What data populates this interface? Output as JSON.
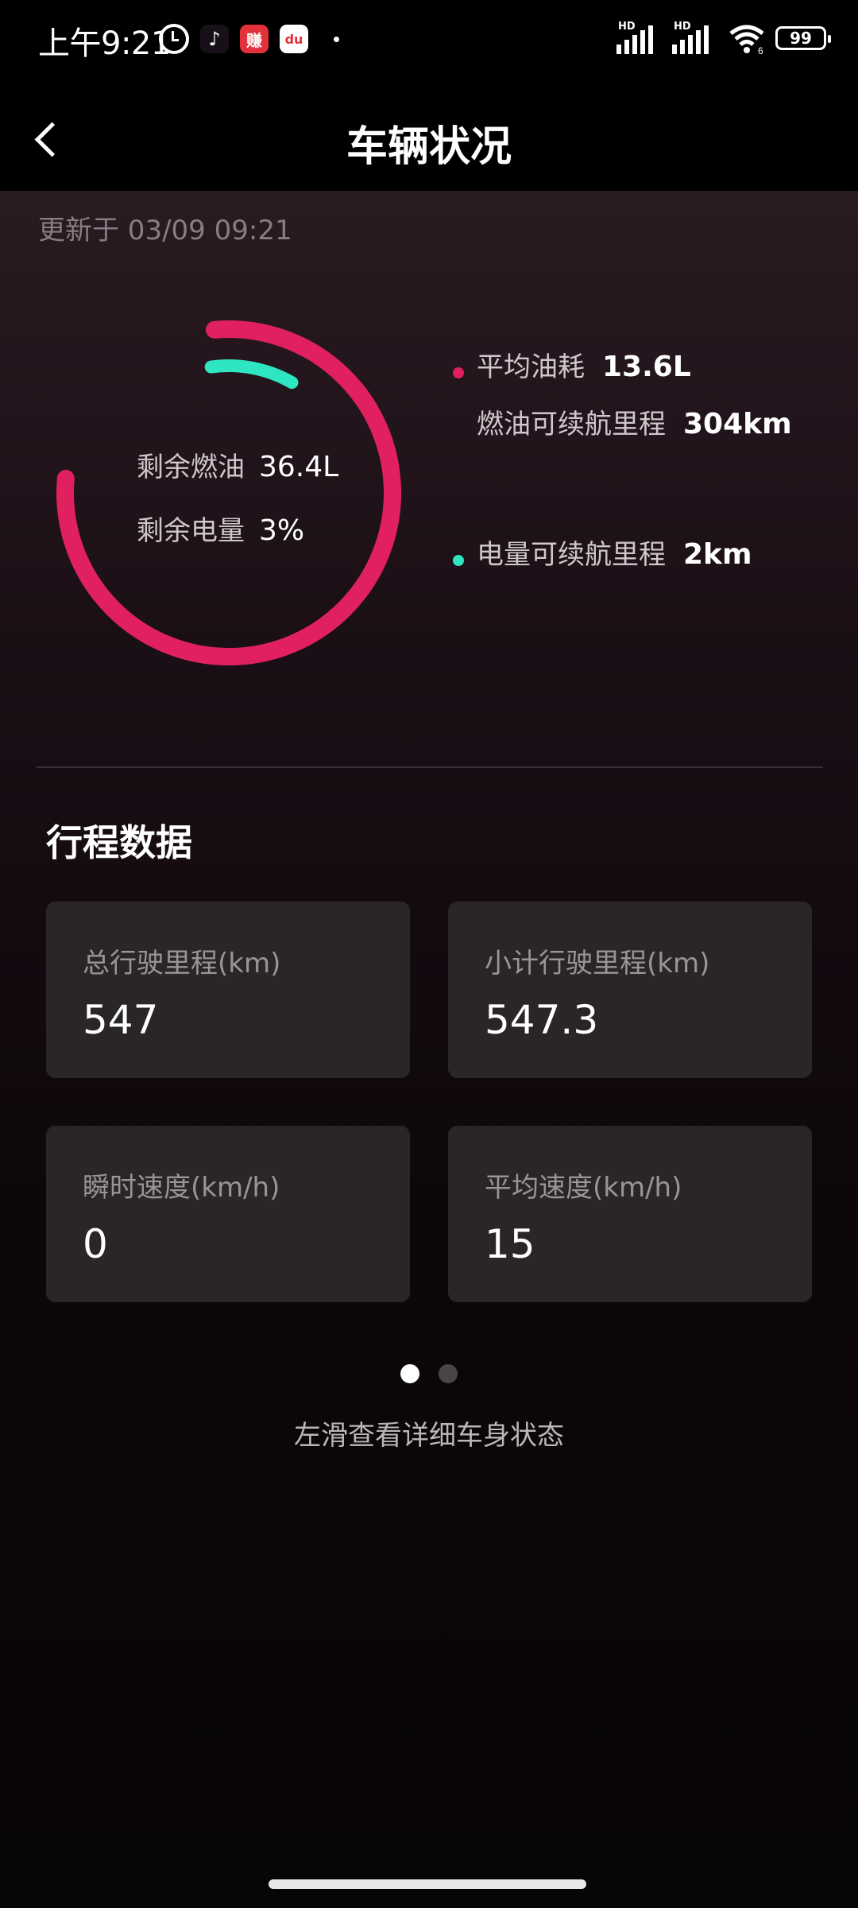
{
  "status_bar": {
    "time": "上午9:21",
    "app_icons": [
      "alarm-icon",
      "tiktok-icon",
      "earn-app-icon",
      "du-app-icon"
    ],
    "earn_label": "赚",
    "du_label": "du",
    "network_1": "HD",
    "network_2": "HD",
    "wifi_label": "6",
    "battery": "99"
  },
  "header": {
    "title": "车辆状况",
    "back_icon": "chevron-left-icon"
  },
  "update_time": "更新于 03/09 09:21",
  "gauge": {
    "fuel_label": "剩余燃油",
    "fuel_value": "36.4L",
    "battery_label": "剩余电量",
    "battery_value": "3%",
    "battery_level": 0.03,
    "fuel_color": "#e0205f",
    "battery_color": "#2ee6c1"
  },
  "legend": {
    "avg_fuel_label": "平均油耗",
    "avg_fuel_value": "13.6L",
    "fuel_range_label": "燃油可续航里程",
    "fuel_range_value": "304km",
    "electric_range_label": "电量可续航里程",
    "electric_range_value": "2km"
  },
  "trip": {
    "section_title": "行程数据",
    "cards": [
      {
        "label": "总行驶里程(km)",
        "value": "547"
      },
      {
        "label": "小计行驶里程(km)",
        "value": "547.3"
      },
      {
        "label": "瞬时速度(km/h)",
        "value": "0"
      },
      {
        "label": "平均速度(km/h)",
        "value": "15"
      }
    ]
  },
  "pager": {
    "pages": 2,
    "active": 1
  },
  "hint": "左滑查看详细车身状态"
}
